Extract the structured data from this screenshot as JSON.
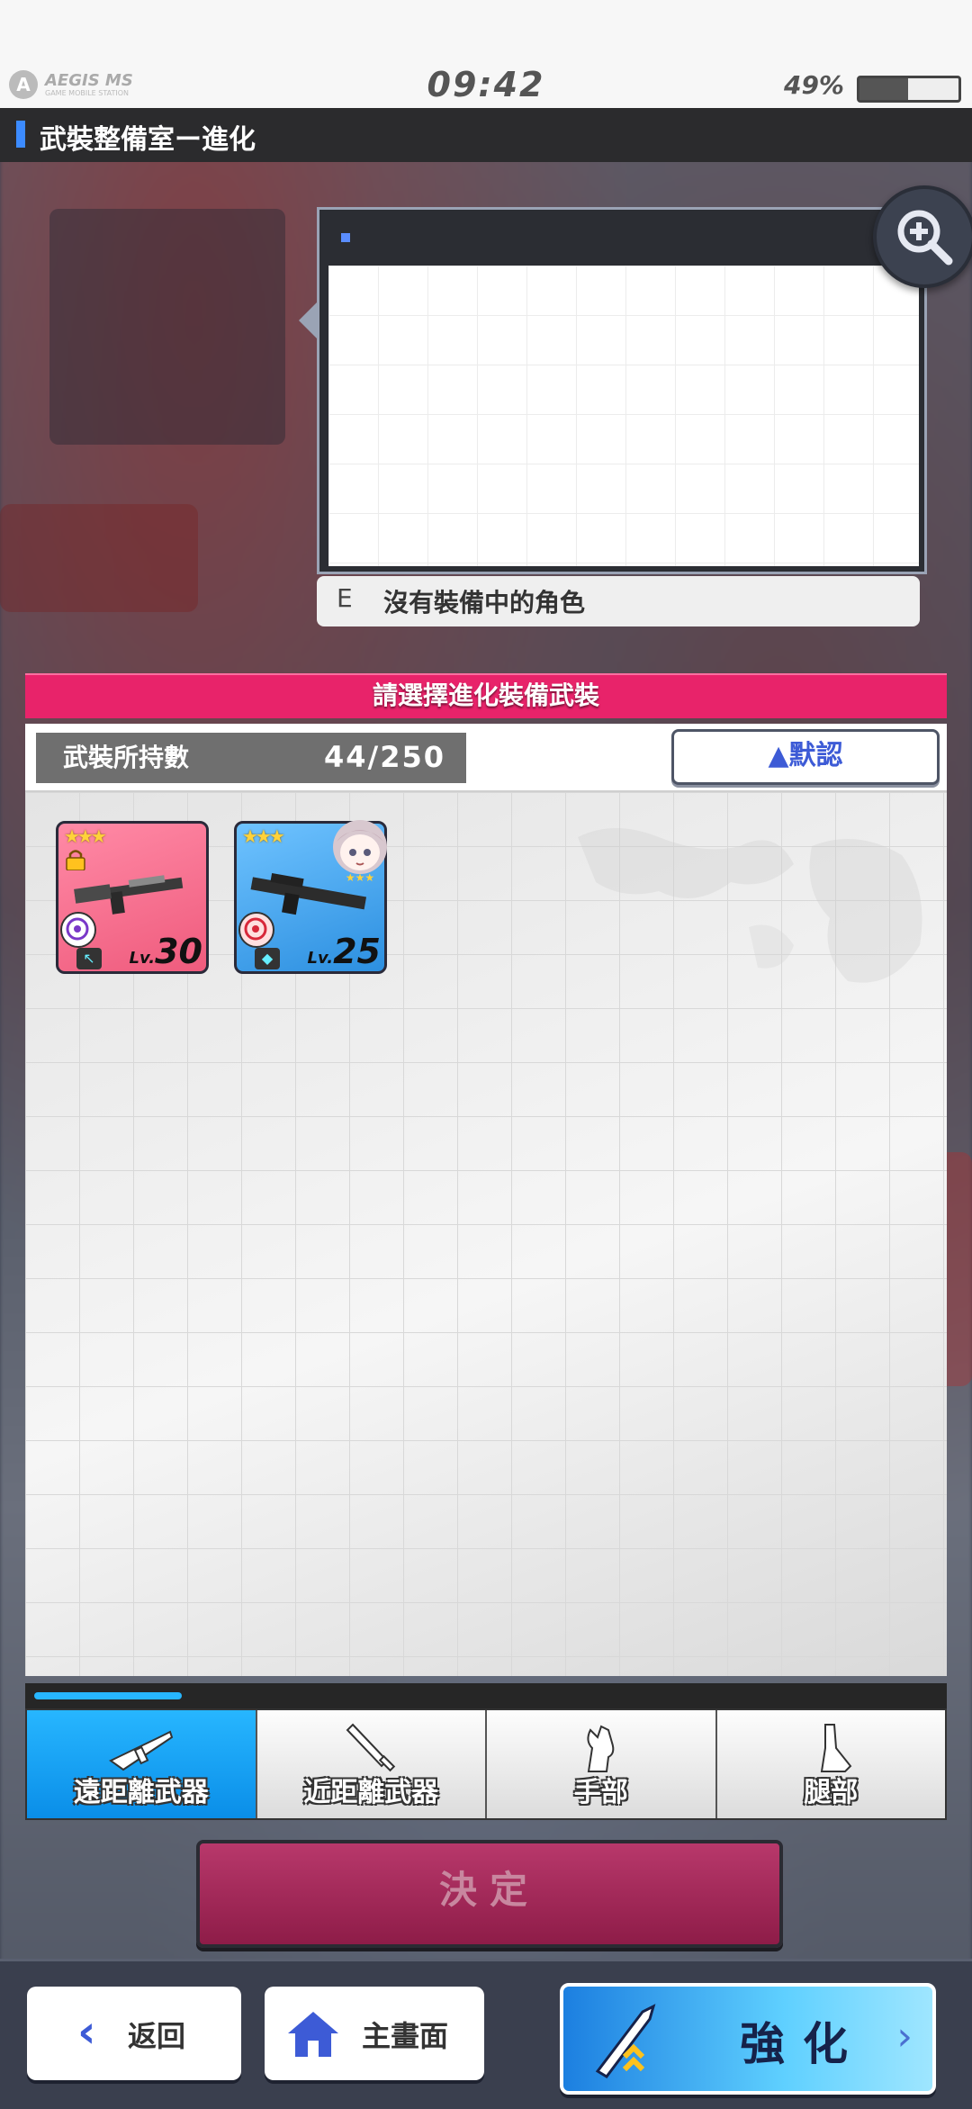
{
  "status_bar": {
    "logo_text": "AEGIS MS",
    "logo_sub": "GAME MOBILE STATION",
    "time": "09:42",
    "battery_percent": "49%",
    "battery_level": 0.49
  },
  "header": {
    "title": "武裝整備室ー進化"
  },
  "preview": {
    "equip_grade": "E",
    "equip_status": "沒有裝備中的角色"
  },
  "panel": {
    "title": "請選擇進化裝備武裝",
    "count_label": "武裝所持數",
    "count_value": "44/250",
    "sort_label": "▲默認"
  },
  "cards": [
    {
      "rarity": "★★★",
      "lv_prefix": "Lv.",
      "level": "30",
      "locked": true,
      "color": "pink"
    },
    {
      "rarity": "★★★",
      "lv_prefix": "Lv.",
      "level": "25",
      "locked": false,
      "color": "blue"
    }
  ],
  "tabs": [
    {
      "label": "遠距離武器",
      "active": true
    },
    {
      "label": "近距離武器",
      "active": false
    },
    {
      "label": "手部",
      "active": false
    },
    {
      "label": "腿部",
      "active": false
    }
  ],
  "tab_scroll_fraction": 0.16,
  "decide_label": "決定",
  "footer": {
    "back_label": "返回",
    "home_label": "主畫面",
    "enhance_label": "強化"
  },
  "colors": {
    "accent_pink": "#e8236a",
    "accent_blue": "#27b6ff",
    "sort_text": "#3d5bd6"
  }
}
